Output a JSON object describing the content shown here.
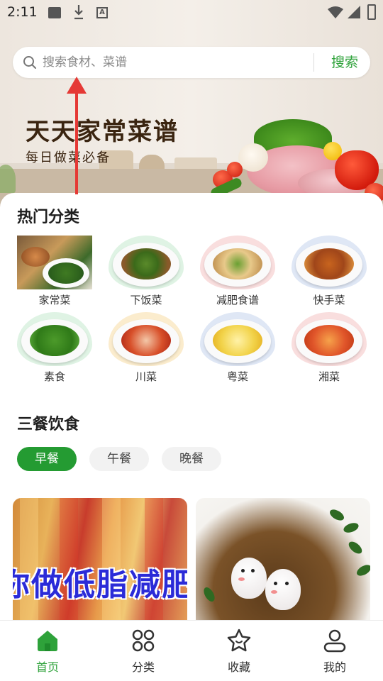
{
  "status_bar": {
    "time": "2:11",
    "icons": [
      "image-icon",
      "download-icon",
      "a-icon",
      "wifi-icon",
      "signal-icon",
      "battery-icon"
    ]
  },
  "search": {
    "placeholder": "搜索食材、菜谱",
    "button_label": "搜索"
  },
  "hero": {
    "title": "天天家常菜谱",
    "subtitle": "每日做菜必备"
  },
  "hot_categories": {
    "title": "热门分类",
    "items": [
      {
        "label": "家常菜",
        "bg": "#ffffff"
      },
      {
        "label": "下饭菜",
        "bg": "#dff3e4"
      },
      {
        "label": "减肥食谱",
        "bg": "#f9dede"
      },
      {
        "label": "快手菜",
        "bg": "#dfe7f5"
      },
      {
        "label": "素食",
        "bg": "#dff3e4"
      },
      {
        "label": "川菜",
        "bg": "#fbeccd"
      },
      {
        "label": "粤菜",
        "bg": "#dfe7f5"
      },
      {
        "label": "湘菜",
        "bg": "#f9dede"
      }
    ]
  },
  "meals": {
    "title": "三餐饮食",
    "tabs": [
      {
        "label": "早餐",
        "active": true
      },
      {
        "label": "午餐",
        "active": false
      },
      {
        "label": "晚餐",
        "active": false
      }
    ]
  },
  "cards": [
    {
      "overlay_text": "你做低脂减肥"
    },
    {
      "overlay_text": ""
    }
  ],
  "bottom_nav": [
    {
      "label": "首页",
      "icon": "home-icon",
      "active": true
    },
    {
      "label": "分类",
      "icon": "grid-icon",
      "active": false
    },
    {
      "label": "收藏",
      "icon": "star-icon",
      "active": false
    },
    {
      "label": "我的",
      "icon": "user-icon",
      "active": false
    }
  ],
  "colors": {
    "accent": "#2ea23a",
    "active_tab": "#249b32",
    "arrow": "#e53935"
  }
}
